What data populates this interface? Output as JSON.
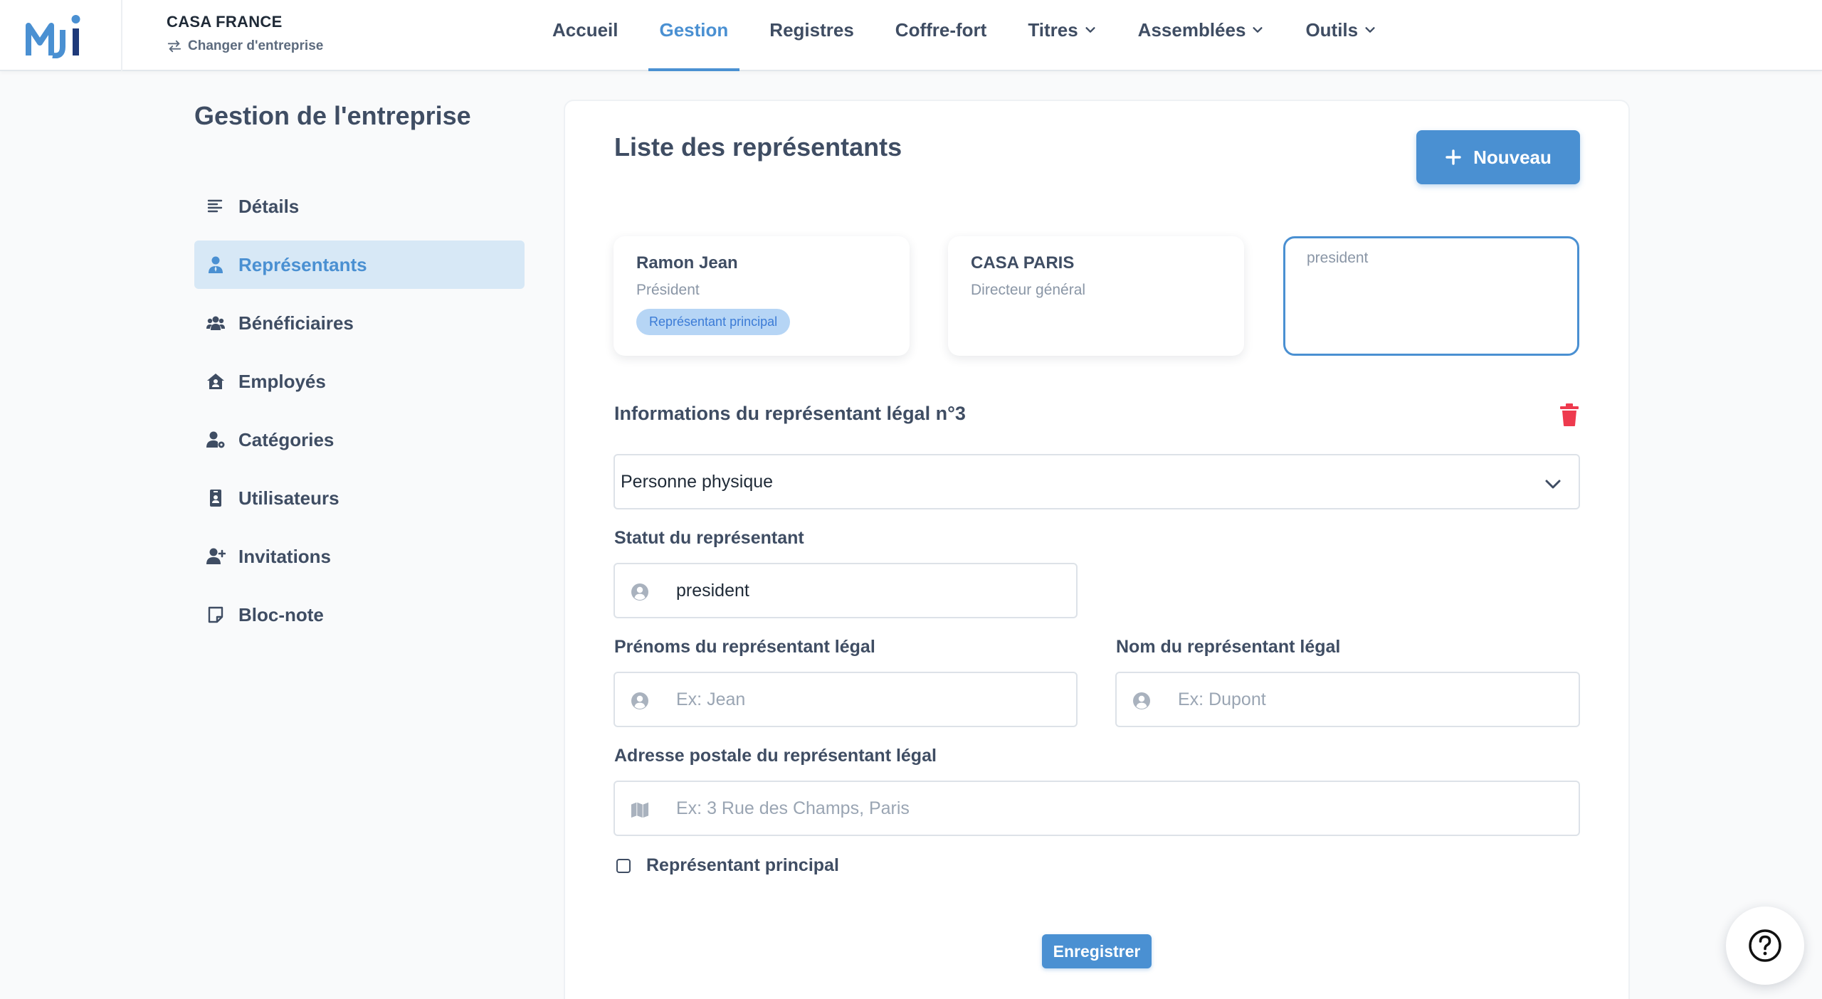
{
  "header": {
    "company_name": "CASA FRANCE",
    "switch_company": "Changer d'entreprise",
    "nav": [
      {
        "label": "Accueil"
      },
      {
        "label": "Gestion"
      },
      {
        "label": "Registres"
      },
      {
        "label": "Coffre-fort"
      },
      {
        "label": "Titres"
      },
      {
        "label": "Assemblées"
      },
      {
        "label": "Outils"
      }
    ]
  },
  "sidebar": {
    "title": "Gestion de l'entreprise",
    "items": [
      {
        "label": "Détails",
        "icon": "align-left-icon"
      },
      {
        "label": "Représentants",
        "icon": "user-tie-icon"
      },
      {
        "label": "Bénéficiaires",
        "icon": "users-icon"
      },
      {
        "label": "Employés",
        "icon": "house-user-icon"
      },
      {
        "label": "Catégories",
        "icon": "user-gear-icon"
      },
      {
        "label": "Utilisateurs",
        "icon": "id-badge-icon"
      },
      {
        "label": "Invitations",
        "icon": "user-plus-icon"
      },
      {
        "label": "Bloc-note",
        "icon": "note-icon"
      }
    ]
  },
  "main": {
    "title": "Liste des représentants",
    "new_button": "Nouveau",
    "cards": [
      {
        "name": "Ramon Jean",
        "role": "Président",
        "badge": "Représentant principal"
      },
      {
        "name": "CASA PARIS",
        "role": "Directeur général"
      },
      {
        "role": "president"
      }
    ],
    "section_title": "Informations du représentant légal n°3",
    "type_select": "Personne physique",
    "status_label": "Statut du représentant",
    "status_value": "president",
    "firstname_label": "Prénoms du représentant légal",
    "firstname_placeholder": "Ex: Jean",
    "lastname_label": "Nom du représentant légal",
    "lastname_placeholder": "Ex: Dupont",
    "address_label": "Adresse postale du représentant légal",
    "address_placeholder": "Ex: 3 Rue des Champs, Paris",
    "principal_checkbox": "Représentant principal",
    "save_button": "Enregistrer"
  },
  "colors": {
    "accent": "#4a90d2",
    "danger": "#ee3a4e",
    "text": "#3f4d63",
    "badge_bg": "#b6d5f5"
  }
}
